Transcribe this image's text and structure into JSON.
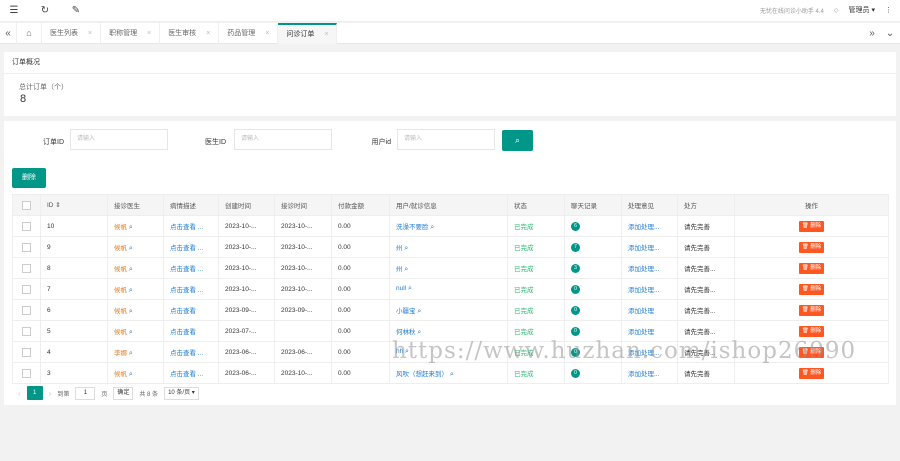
{
  "topbar": {
    "icons": [
      "menu-icon",
      "refresh-icon",
      "brush-icon"
    ],
    "notice": "无忧在线问诊小助手 4.4",
    "admin_label": "管理员 ▾",
    "more_glyph": "⋮"
  },
  "tabbar": {
    "tabs": [
      {
        "label": "医生列表",
        "close": "×"
      },
      {
        "label": "职称管理",
        "close": "×"
      },
      {
        "label": "医生审核",
        "close": "×"
      },
      {
        "label": "药品管理",
        "close": "×"
      },
      {
        "label": "问诊订单",
        "close": "×"
      }
    ],
    "active_index": 4
  },
  "overview": {
    "title": "订单概况",
    "total_label": "总计订单（个）",
    "total_value": "8"
  },
  "search": {
    "order_id_label": "订单ID",
    "order_id_placeholder": "请输入",
    "doctor_id_label": "医生ID",
    "doctor_id_placeholder": "请输入",
    "user_id_label": "用户id",
    "user_id_placeholder": "请输入"
  },
  "toolbar": {
    "delete_label": "删除"
  },
  "table": {
    "headers": [
      "ID ⇕",
      "接诊医生",
      "病情描述",
      "创建时间",
      "接诊时间",
      "付款金额",
      "用户/就诊信息",
      "状态",
      "聊天记录",
      "处理意见",
      "处方",
      "操作"
    ],
    "rows": [
      {
        "id": "10",
        "doctor": "候帆",
        "desc": "点击查看 ...",
        "created": "2023-10-...",
        "received": "2023-10-...",
        "amount": "0.00",
        "user": "洗澡不要脸",
        "status": "已完成",
        "chats": "6",
        "advice": "添加处理...",
        "rx": "请先完善",
        "op": "删除"
      },
      {
        "id": "9",
        "doctor": "候帆",
        "desc": "点击查看 ...",
        "created": "2023-10-...",
        "received": "2023-10-...",
        "amount": "0.00",
        "user": "州",
        "status": "已完成",
        "chats": "7",
        "advice": "添加处理...",
        "rx": "请先完善",
        "op": "删除"
      },
      {
        "id": "8",
        "doctor": "候帆",
        "desc": "点击查看 ...",
        "created": "2023-10-...",
        "received": "2023-10-...",
        "amount": "0.00",
        "user": "州",
        "status": "已完成",
        "chats": "3",
        "advice": "添加处理...",
        "rx": "请先完善...",
        "op": "删除"
      },
      {
        "id": "7",
        "doctor": "候帆",
        "desc": "点击查看 ...",
        "created": "2023-10-...",
        "received": "2023-10-...",
        "amount": "0.00",
        "user": "null",
        "status": "已完成",
        "chats": "0",
        "advice": "添加处理...",
        "rx": "请先完善...",
        "op": "删除"
      },
      {
        "id": "6",
        "doctor": "候帆",
        "desc": "点击查看",
        "created": "2023-09-...",
        "received": "2023-09-...",
        "amount": "0.00",
        "user": "小疆宝",
        "status": "已完成",
        "chats": "0",
        "advice": "添加处理",
        "rx": "请先完善...",
        "op": "删除"
      },
      {
        "id": "5",
        "doctor": "候帆",
        "desc": "点击查看",
        "created": "2023-07-...",
        "received": "",
        "amount": "0.00",
        "user": "何林秋",
        "status": "已完成",
        "chats": "0",
        "advice": "添加处理",
        "rx": "请先完善...",
        "op": "删除"
      },
      {
        "id": "4",
        "doctor": "李娜",
        "desc": "点击查看 ...",
        "created": "2023-06-...",
        "received": "2023-06-...",
        "amount": "0.00",
        "user": "hh",
        "status": "已完成",
        "chats": "0",
        "advice": "添加处理...",
        "rx": "请先完善...",
        "op": "删除"
      },
      {
        "id": "3",
        "doctor": "候帆",
        "desc": "点击查看 ...",
        "created": "2023-06-...",
        "received": "2023-10-...",
        "amount": "0.00",
        "user": "风吹（想赶来到）",
        "status": "已完成",
        "chats": "0",
        "advice": "添加处理...",
        "rx": "请先完善",
        "op": "删除"
      }
    ]
  },
  "pager": {
    "prev": "‹",
    "current": "1",
    "next": "›",
    "goto_label": "到第",
    "goto_value": "1",
    "page_unit": "页",
    "confirm": "确定",
    "total": "共 8 条",
    "per_page": "10 条/页 ▾"
  },
  "watermark": "https://www.huzhan.com/ishop26990",
  "colors": {
    "accent": "#009688",
    "danger": "#ff5722",
    "link": "#1e7bd4",
    "warn": "#e67e22",
    "success": "#2eb873"
  }
}
